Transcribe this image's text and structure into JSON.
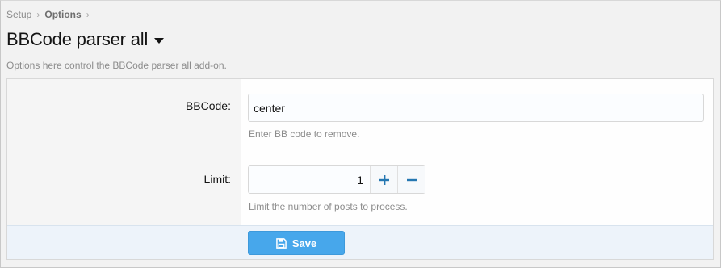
{
  "breadcrumb": {
    "items": [
      "Setup",
      "Options"
    ],
    "separator": "›"
  },
  "page": {
    "title": "BBCode parser all",
    "description": "Options here control the BBCode parser all add-on."
  },
  "form": {
    "bbcode": {
      "label": "BBCode:",
      "value": "center",
      "hint": "Enter BB code to remove."
    },
    "limit": {
      "label": "Limit:",
      "value": "1",
      "hint": "Limit the number of posts to process."
    }
  },
  "footer": {
    "save_label": "Save",
    "save_icon": "floppy-disk-icon"
  },
  "colors": {
    "accent": "#47a7eb",
    "stepper_icon": "#2577b1",
    "footer_bg": "#edf3fa"
  }
}
